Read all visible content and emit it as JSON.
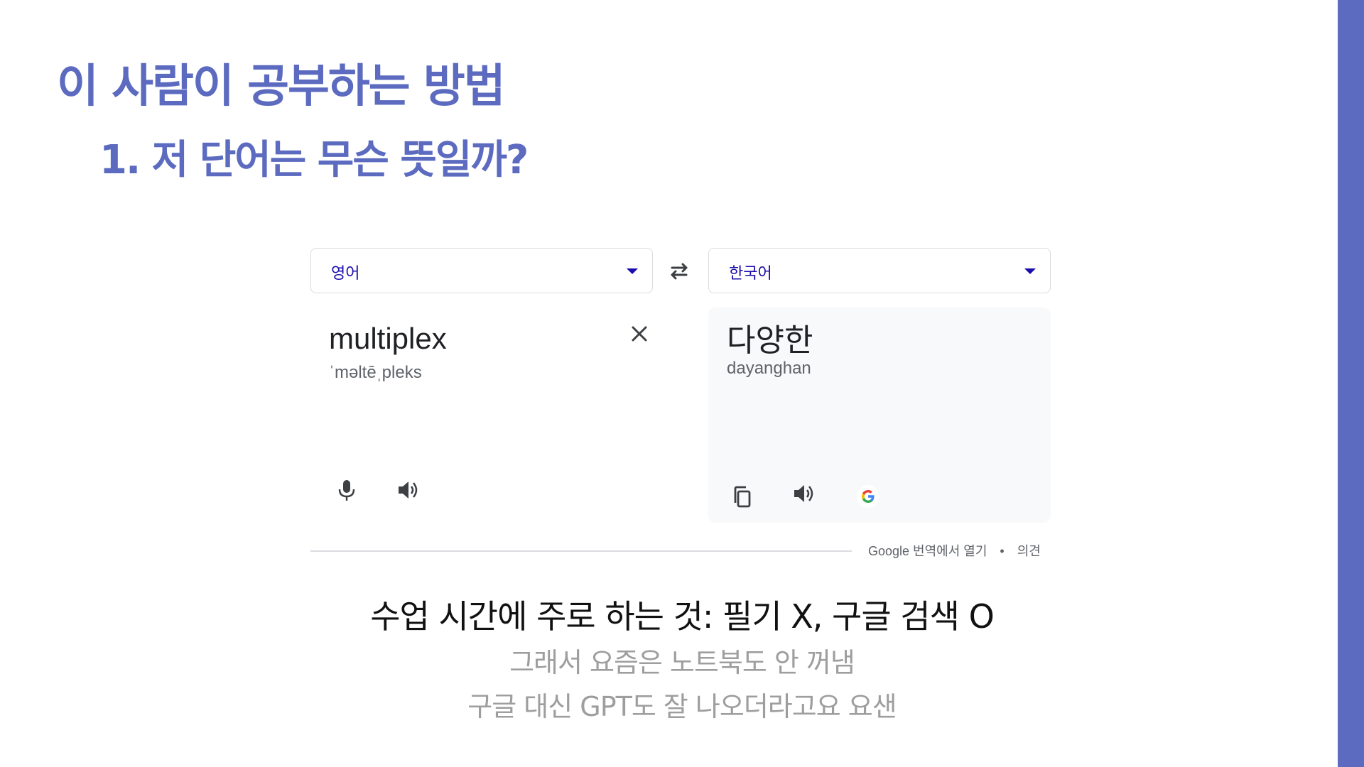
{
  "slide": {
    "title": "이 사람이 공부하는 방법",
    "subtitle": "1. 저 단어는 무슨 뜻일까?",
    "accent_color": "#5c6bc0"
  },
  "translate": {
    "source_language": "영어",
    "target_language": "한국어",
    "source_text": "multiplex",
    "source_phonetic": "ˈməltēˌpleks",
    "target_text": "다양한",
    "target_romanization": "dayanghan",
    "icons": {
      "swap": "swap-arrows-icon",
      "clear": "close-icon",
      "mic": "microphone-icon",
      "listen": "speaker-icon",
      "copy": "copy-icon",
      "google": "google-g-icon"
    },
    "footer": {
      "open_link": "Google 번역에서 열기",
      "separator": "•",
      "feedback": "의견"
    }
  },
  "notes": {
    "line1": "수업 시간에 주로 하는 것: 필기 X, 구글 검색 O",
    "line2": "그래서 요즘은 노트북도 안 꺼냄",
    "line3": "구글 대신 GPT도 잘 나오더라고요 요샌"
  }
}
